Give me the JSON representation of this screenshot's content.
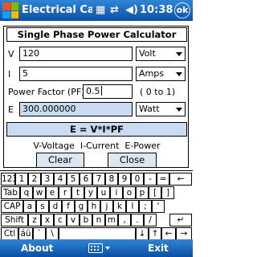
{
  "status_bar": {
    "title": "Electrical Calc",
    "icons": [
      "windows-logo-icon",
      "toolbar-icon",
      "connectivity-icon",
      "volume-icon",
      "ok-icon"
    ],
    "time": "10:38",
    "ok_label": "ok"
  },
  "form": {
    "heading": "Single Phase Power Calculator",
    "voltage": {
      "label": "V",
      "value": "120",
      "unit": "Volt"
    },
    "current": {
      "label": "I",
      "value": "5",
      "unit": "Amps"
    },
    "power_factor": {
      "label": "Power Factor (PF)",
      "value": "0.5",
      "range": "( 0 to 1)"
    },
    "energy": {
      "label": "E",
      "value": "300.000000",
      "unit": "Watt"
    },
    "formula": "E = V*I*PF",
    "legend": "V-Voltage  I-Current  E-Power",
    "clear_label": "Clear",
    "close_label": "Close"
  },
  "keyboard": {
    "rows": [
      [
        "123",
        "1",
        "2",
        "3",
        "4",
        "5",
        "6",
        "7",
        "8",
        "9",
        "0",
        "-",
        "=",
        "←"
      ],
      [
        "Tab",
        "q",
        "w",
        "e",
        "r",
        "t",
        "y",
        "u",
        "i",
        "o",
        "p",
        "[",
        "]"
      ],
      [
        "CAP",
        "a",
        "s",
        "d",
        "f",
        "g",
        "h",
        "j",
        "k",
        "l",
        ";",
        "'"
      ],
      [
        "Shift",
        "z",
        "x",
        "c",
        "v",
        "b",
        "n",
        "m",
        ",",
        ".",
        "/",
        "↵"
      ],
      [
        "Ctl",
        "áü",
        "`",
        "\\",
        "",
        "↓",
        "↑",
        "←",
        "→"
      ]
    ]
  },
  "menu_bar": {
    "left": "About",
    "right": "Exit"
  },
  "colors": {
    "title_bar": "#0a4ea8",
    "readonly_field": "#c9dcf2",
    "button": "#dbe6f3"
  }
}
